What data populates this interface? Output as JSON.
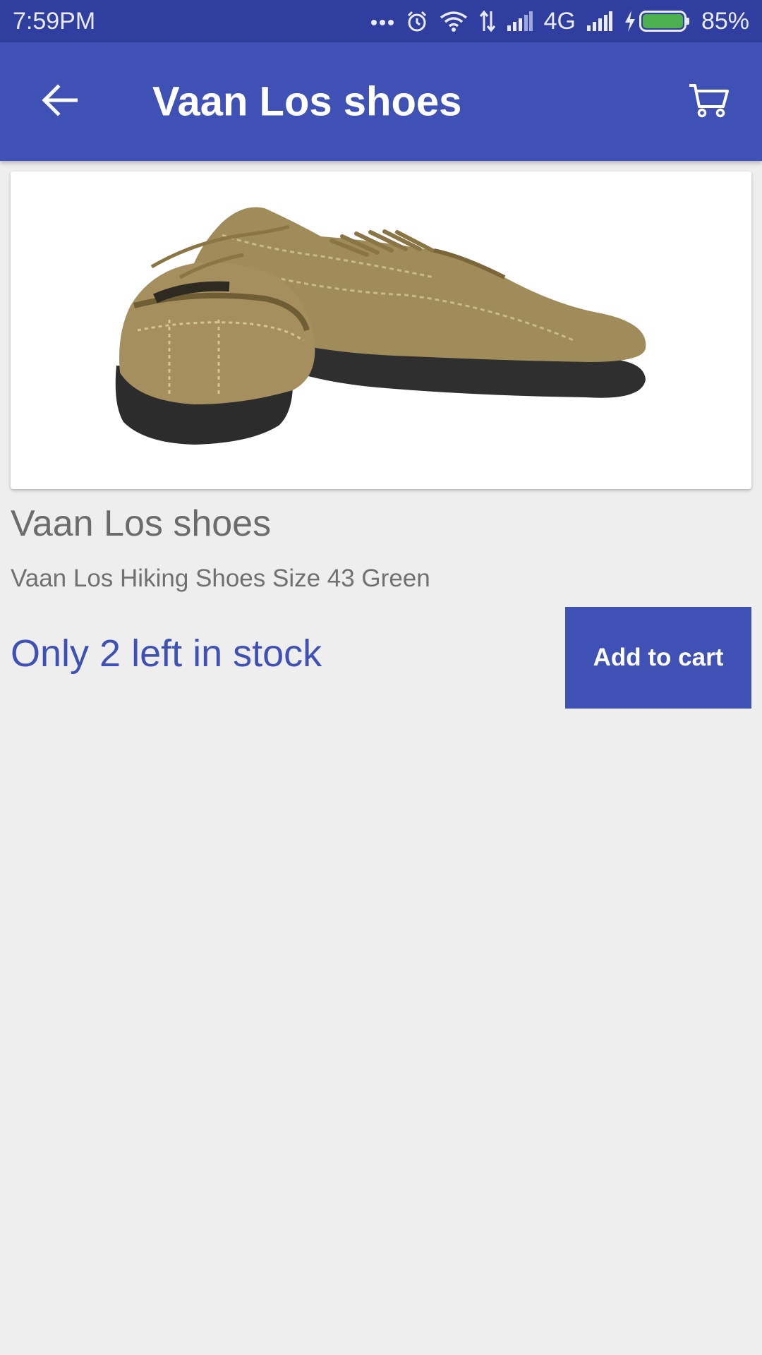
{
  "status_bar": {
    "time": "7:59PM",
    "network": "4G",
    "battery": "85%",
    "icons": [
      "more-dots-icon",
      "alarm-icon",
      "wifi-icon",
      "data-arrows-icon",
      "signal-icon",
      "signal-icon",
      "charging-icon",
      "battery-icon"
    ]
  },
  "app_bar": {
    "title": "Vaan Los shoes",
    "back_icon": "arrow-back-icon",
    "cart_icon": "shopping-cart-icon"
  },
  "product": {
    "image": "shoe-pair-image",
    "title": "Vaan Los shoes",
    "description": "Vaan Los Hiking Shoes Size 43 Green",
    "stock": "Only 2 left in stock",
    "add_to_cart_label": "Add to cart"
  },
  "colors": {
    "primary": "#3f51b5",
    "primary_dark": "#303f9f",
    "background": "#eeeeee",
    "battery_green": "#4caf50"
  }
}
